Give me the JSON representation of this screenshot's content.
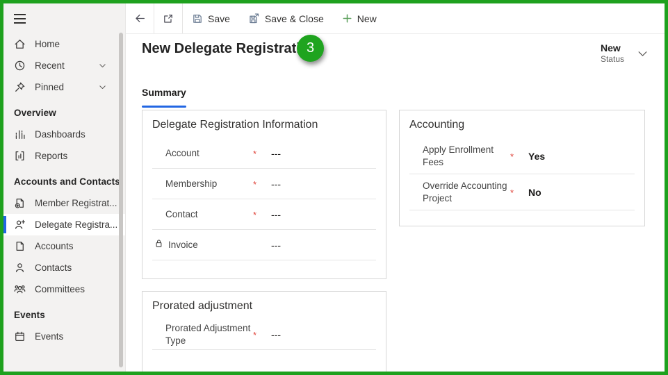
{
  "colors": {
    "annotation_green": "#1fa41f",
    "accent_blue": "#2266e3",
    "required_red": "#e0453c",
    "sidebar_bg": "#f3f2f1"
  },
  "annotation": {
    "badge": "3"
  },
  "sidebar": {
    "sections": [
      {
        "items": [
          {
            "label": "Home"
          },
          {
            "label": "Recent"
          },
          {
            "label": "Pinned"
          }
        ]
      },
      {
        "header": "Overview",
        "items": [
          {
            "label": "Dashboards"
          },
          {
            "label": "Reports"
          }
        ]
      },
      {
        "header": "Accounts and Contacts",
        "items": [
          {
            "label": "Member Registrat..."
          },
          {
            "label": "Delegate Registra..."
          },
          {
            "label": "Accounts"
          },
          {
            "label": "Contacts"
          },
          {
            "label": "Committees"
          }
        ]
      },
      {
        "header": "Events",
        "items": [
          {
            "label": "Events"
          }
        ]
      }
    ]
  },
  "toolbar": {
    "save_label": "Save",
    "save_and_close_label": "Save & Close",
    "new_label": "New"
  },
  "header": {
    "title": "New Delegate Registration",
    "status_value": "New",
    "status_label": "Status"
  },
  "tabs": {
    "summary_label": "Summary"
  },
  "form": {
    "registration": {
      "title": "Delegate Registration Information",
      "fields": [
        {
          "label": "Account",
          "required": "*",
          "value": "---"
        },
        {
          "label": "Membership",
          "required": "*",
          "value": "---"
        },
        {
          "label": "Contact",
          "required": "*",
          "value": "---"
        },
        {
          "label": "Invoice",
          "required": "",
          "value": "---"
        }
      ]
    },
    "accounting": {
      "title": "Accounting",
      "fields": [
        {
          "label": "Apply Enrollment Fees",
          "required": "*",
          "value": "Yes"
        },
        {
          "label": "Override Accounting Project",
          "required": "*",
          "value": "No"
        }
      ]
    },
    "prorated": {
      "title": "Prorated adjustment",
      "fields": [
        {
          "label": "Prorated Adjustment Type",
          "required": "*",
          "value": "---"
        }
      ]
    }
  }
}
